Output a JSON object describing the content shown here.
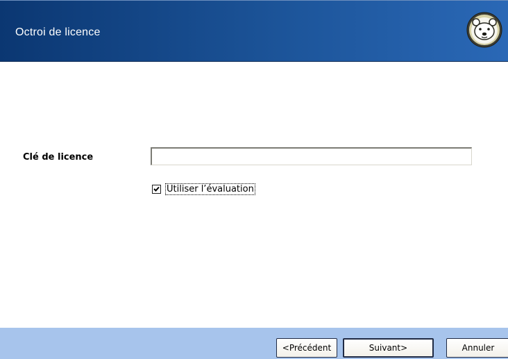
{
  "header": {
    "title": "Octroi de licence",
    "logo_icon": "polar-bear-icon"
  },
  "form": {
    "license_key_label": "Clé de licence",
    "license_key_value": "",
    "license_key_placeholder": "",
    "evaluation_checkbox_label": "Utiliser l’évaluation",
    "evaluation_checked": true
  },
  "buttons": {
    "previous_label": "<Précédent",
    "next_label": "Suivant>",
    "cancel_label": "Annuler"
  },
  "colors": {
    "header_dark": "#0b3772",
    "header_light": "#2a68b6",
    "footer_bg": "#a7c4ec"
  }
}
